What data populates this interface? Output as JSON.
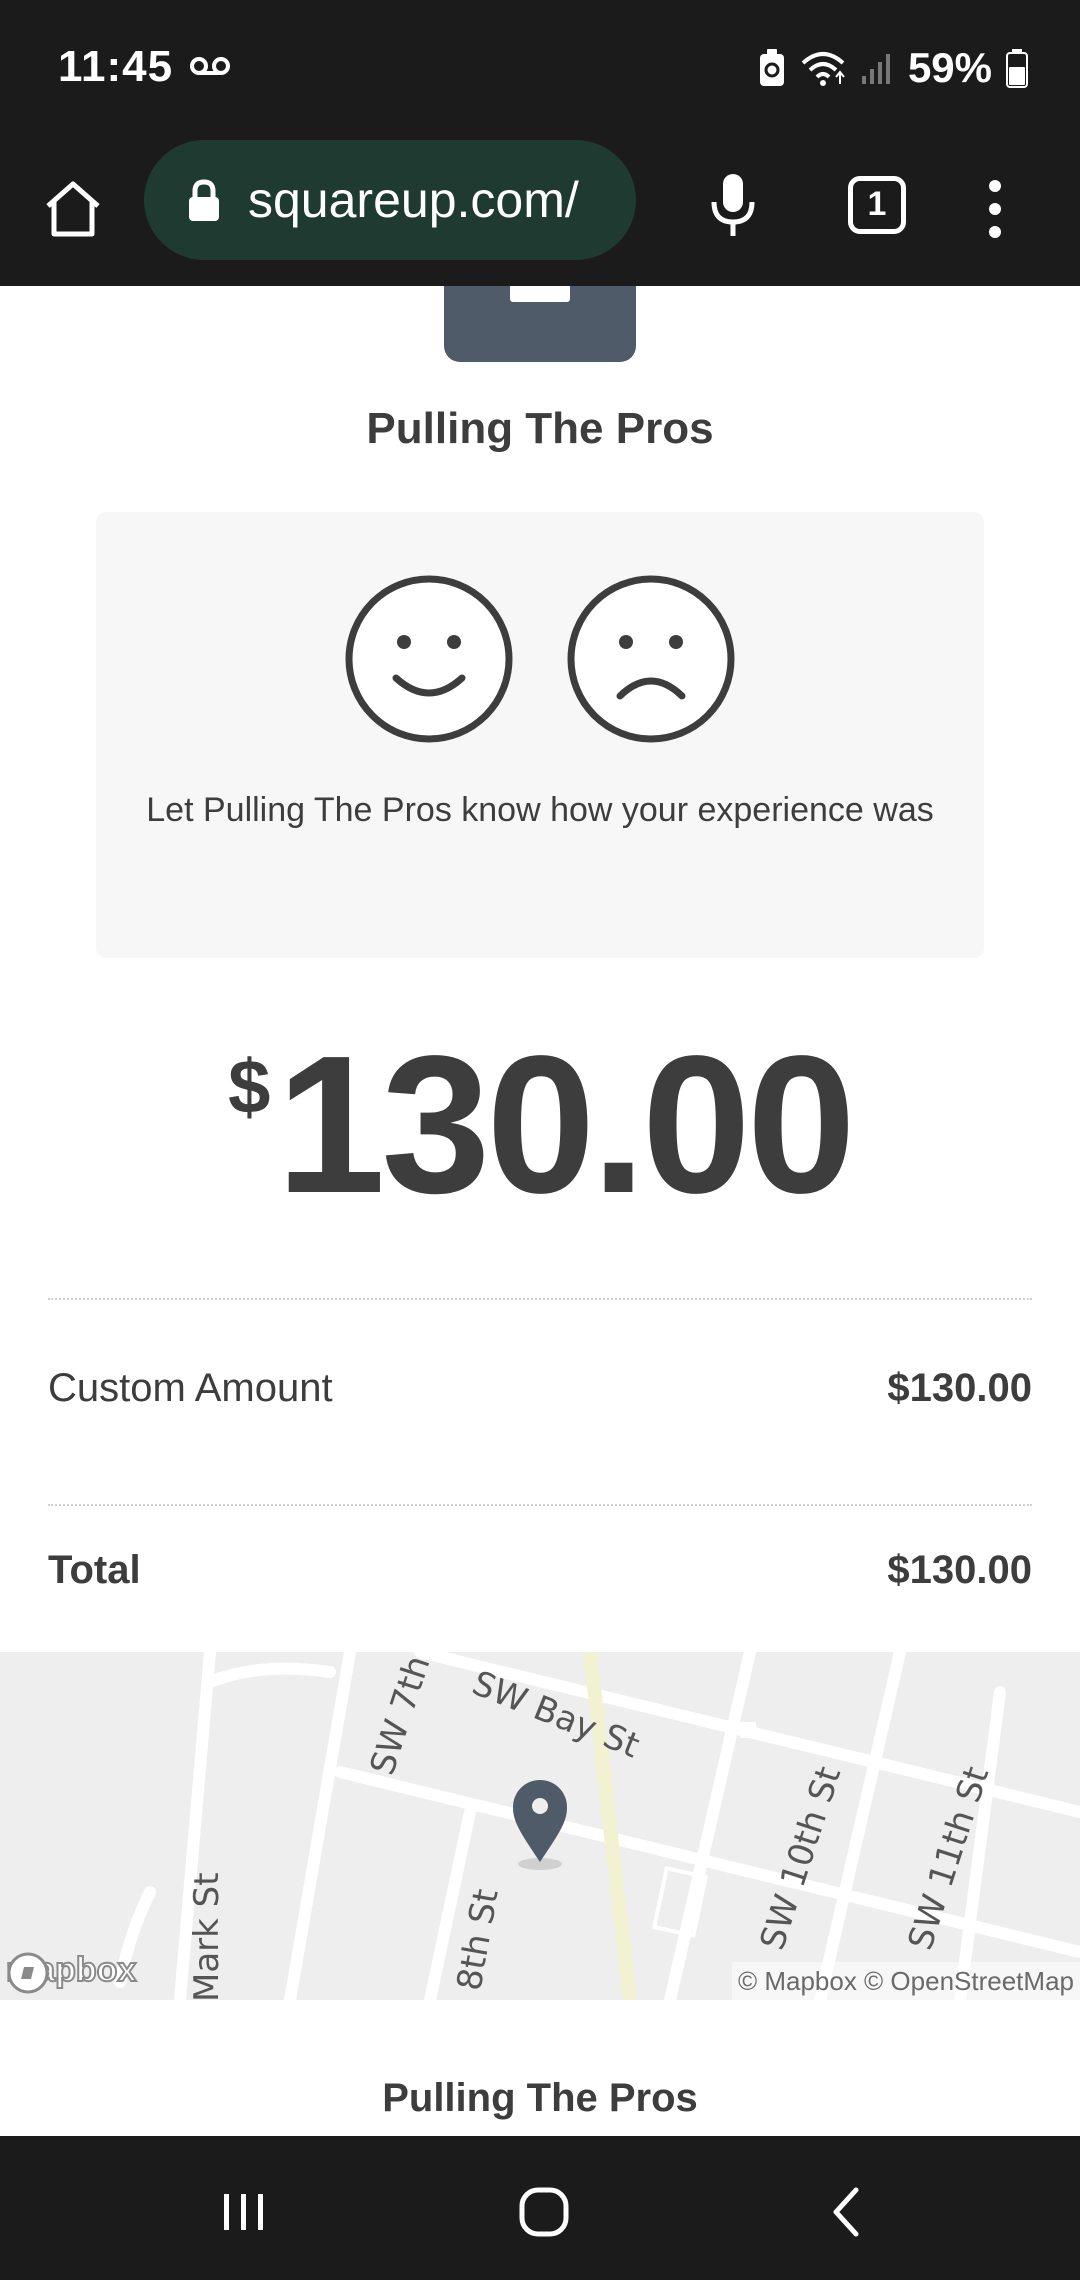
{
  "status_bar": {
    "time": "11:45",
    "battery": "59%",
    "icons": [
      "voicemail-icon",
      "battery-saver-icon",
      "wifi-icon",
      "signal-icon",
      "battery-icon"
    ]
  },
  "browser": {
    "url": "squareup.com/",
    "tab_count": "1",
    "icons": [
      "home-icon",
      "lock-icon",
      "mic-icon",
      "tabs-icon",
      "more-vert-icon"
    ],
    "pill_color": "#1f3a30"
  },
  "merchant": {
    "name": "Pulling The Pros"
  },
  "feedback": {
    "prompt": "Let Pulling The Pros know how your experience was",
    "options": [
      "happy-face-icon",
      "sad-face-icon"
    ]
  },
  "amount": {
    "currency_symbol": "$",
    "value": "130.00"
  },
  "line_items": [
    {
      "label": "Custom Amount",
      "value": "$130.00"
    }
  ],
  "total": {
    "label": "Total",
    "value": "$130.00"
  },
  "map": {
    "streets": [
      "SW 7th",
      "SW Bay St",
      "Mark St",
      "8th St",
      "SW 10th St",
      "SW 11th St"
    ],
    "logo": "mapbox",
    "attribution": "© Mapbox © OpenStreetMap",
    "pin_color": "#4f5b69"
  },
  "footer": {
    "name": "Pulling The Pros"
  },
  "nav_bar": {
    "icons": [
      "recent-apps-icon",
      "home-nav-icon",
      "back-icon"
    ]
  }
}
